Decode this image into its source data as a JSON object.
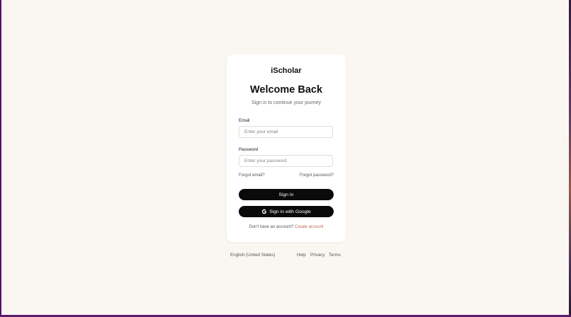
{
  "brand": "iScholar",
  "heading": "Welcome Back",
  "subheading": "Sign in to continue your journey",
  "form": {
    "email_label": "Email",
    "email_placeholder": "Enter your email",
    "password_label": "Password",
    "password_placeholder": "Enter your password",
    "forgot_email": "Forgot email?",
    "forgot_password": "Forgot password?",
    "sign_in_label": "Sign In",
    "google_label": "Sign in with Google"
  },
  "signup": {
    "prompt": "Don't have an account?",
    "link": "Create account"
  },
  "footer": {
    "language": "English (United States)",
    "help": "Help",
    "privacy": "Privacy",
    "terms": "Terms"
  },
  "icons": {
    "google": "google-g-icon"
  },
  "colors": {
    "page_background": "#faf6f2",
    "card_background": "#ffffff",
    "primary_button": "#0a0a0a",
    "accent_link": "#c06a5a",
    "frame": "#4a1a5c"
  }
}
